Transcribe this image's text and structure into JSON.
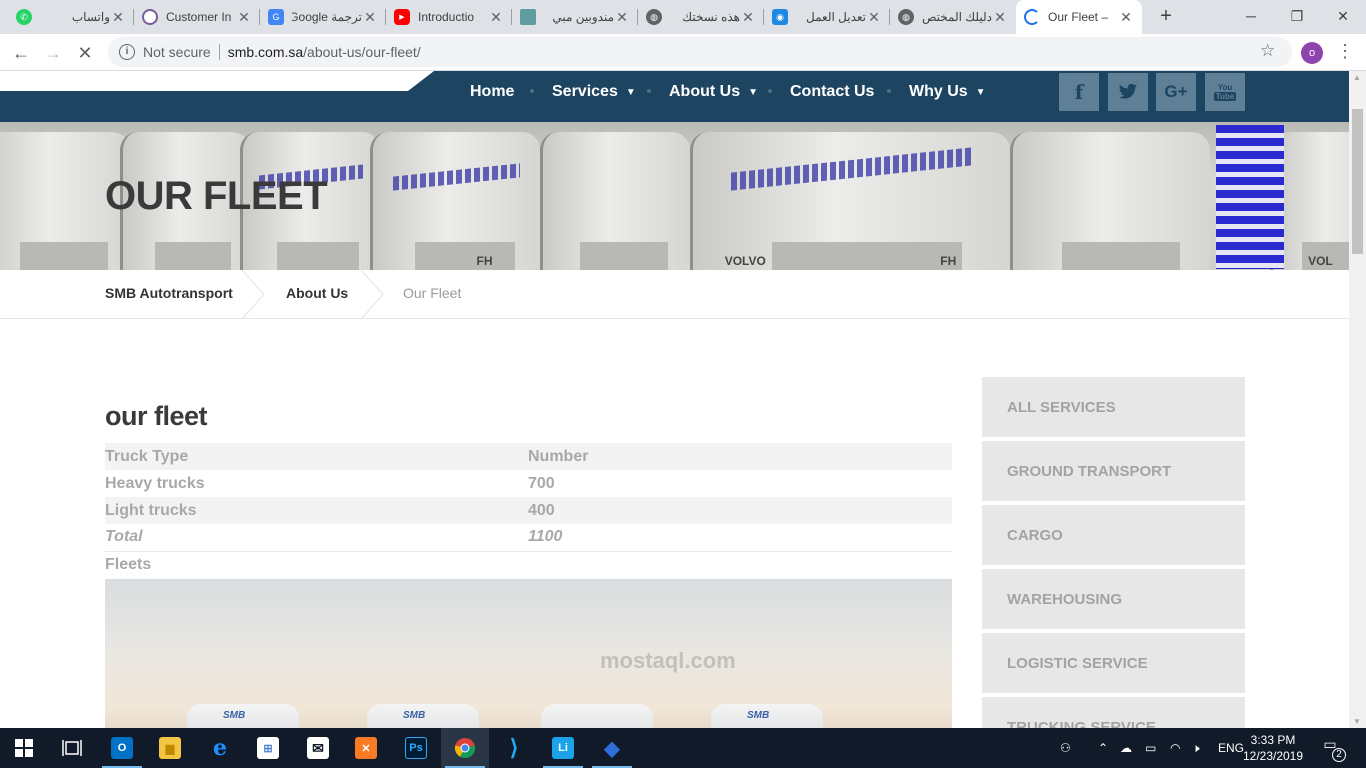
{
  "browser": {
    "tabs": [
      {
        "title": "واتساب",
        "favicon": "whatsapp-icon",
        "color": "#25d366"
      },
      {
        "title": "Customer In",
        "favicon": "globe-icon",
        "color": "#7a5c9e"
      },
      {
        "title": "ترجمة Google",
        "favicon": "google-translate-icon",
        "color": "#4285f4"
      },
      {
        "title": "Introductio",
        "favicon": "youtube-icon",
        "color": "#ff0000"
      },
      {
        "title": "مندوبين مبي",
        "favicon": "site-icon",
        "color": "#5f9ea0"
      },
      {
        "title": "هذه نسختك",
        "favicon": "globe-icon",
        "color": "#5f6368"
      },
      {
        "title": "تعديل العمل",
        "favicon": "site-icon",
        "color": "#1e88e5"
      },
      {
        "title": "دليلك المختص",
        "favicon": "globe-icon",
        "color": "#5f6368"
      },
      {
        "title": "Our Fleet –",
        "favicon": "loading-icon",
        "color": "#1a73e8"
      }
    ],
    "new_tab": "+",
    "window_controls": {
      "minimize": "─",
      "maximize": "❐",
      "close": "✕"
    },
    "address": {
      "security": "Not secure",
      "host": "smb.com.sa",
      "path": "/about-us/our-fleet/"
    },
    "profile_initial": "o"
  },
  "site": {
    "nav": {
      "items": [
        {
          "label": "Home",
          "caret": false
        },
        {
          "label": "Services",
          "caret": true
        },
        {
          "label": "About Us",
          "caret": true
        },
        {
          "label": "Contact Us",
          "caret": false
        },
        {
          "label": "Why Us",
          "caret": true
        }
      ],
      "social": [
        {
          "name": "facebook",
          "glyph": "f"
        },
        {
          "name": "twitter",
          "glyph": "t"
        },
        {
          "name": "google-plus",
          "glyph": "G+"
        },
        {
          "name": "youtube",
          "glyph": "You Tube"
        }
      ]
    },
    "hero": {
      "title": "OUR FLEET",
      "truck_brand": "VOLVO",
      "truck_model": "FH"
    },
    "breadcrumbs": [
      "SMB Autotransport",
      "About Us",
      "Our Fleet"
    ],
    "content": {
      "heading": "our fleet",
      "table": {
        "header": [
          "Truck Type",
          "Number"
        ],
        "rows": [
          [
            "Heavy trucks",
            "700"
          ],
          [
            "Light trucks",
            "400"
          ]
        ],
        "total": [
          "Total",
          "1100"
        ]
      },
      "fleets_label": "Fleets",
      "photo_truck_label": "SMB"
    },
    "sidebar": [
      "ALL SERVICES",
      "GROUND TRANSPORT",
      "CARGO",
      "WAREHOUSING",
      "LOGISTIC SERVICE",
      "TRUCKING SERVICE"
    ],
    "watermark": "mostaql.com"
  },
  "taskbar": {
    "apps": [
      {
        "name": "outlook",
        "label": "O",
        "color": "#0072c6",
        "running": true
      },
      {
        "name": "file-explorer",
        "label": "▆",
        "color": "#f4c542",
        "running": false
      },
      {
        "name": "edge",
        "label": "e",
        "color": "#1e90ff",
        "running": false
      },
      {
        "name": "store",
        "label": "⊞",
        "color": "#4a7fd1",
        "running": false
      },
      {
        "name": "mail",
        "label": "✉",
        "color": "#ffffff",
        "running": false
      },
      {
        "name": "xampp",
        "label": "✕",
        "color": "#fb7a24",
        "running": false
      },
      {
        "name": "photoshop",
        "label": "Ps",
        "color": "#001d34",
        "running": false
      },
      {
        "name": "chrome",
        "label": "●",
        "color": "#db4437",
        "running": true
      },
      {
        "name": "vscode",
        "label": "⟩",
        "color": "#23a9f2",
        "running": false
      },
      {
        "name": "app-li",
        "label": "Li",
        "color": "#1aa3e8",
        "running": true
      },
      {
        "name": "security",
        "label": "◆",
        "color": "#2e6fd9",
        "running": true
      }
    ],
    "language": "ENG",
    "time": "3:33 PM",
    "date": "12/23/2019",
    "notifications": "2"
  }
}
